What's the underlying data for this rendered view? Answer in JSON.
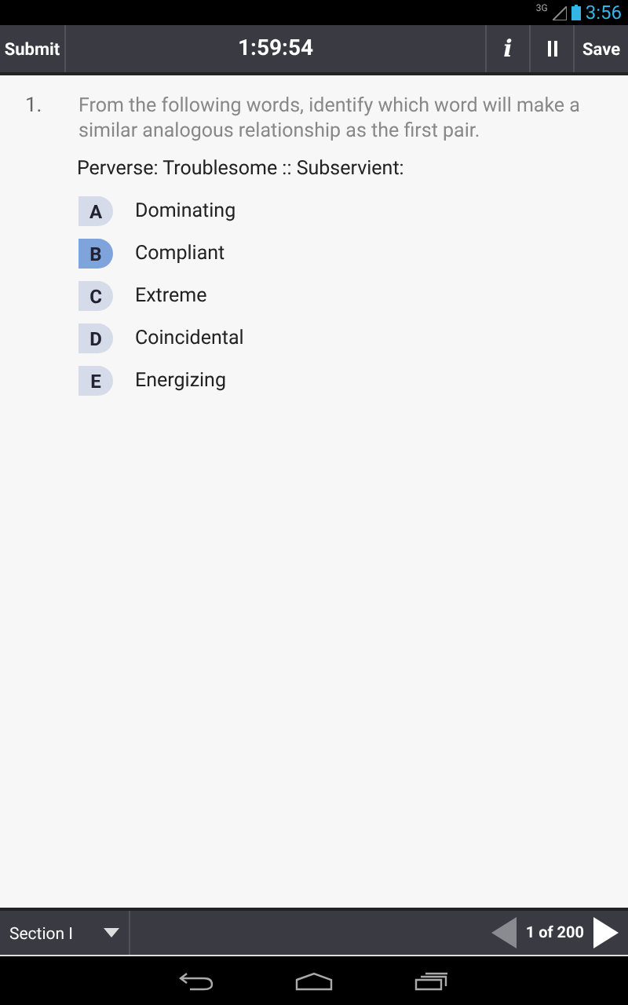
{
  "status_bar": {
    "time": "3:56",
    "network": "3G"
  },
  "toolbar": {
    "submit": "Submit",
    "timer": "1:59:54",
    "info": "i",
    "save": "Save"
  },
  "question": {
    "number": "1.",
    "text": "From the following words, identify which word will make a similar analogous relationship as the first pair.",
    "prompt": "Perverse: Troublesome :: Subservient:"
  },
  "options": [
    {
      "letter": "A",
      "label": "Dominating",
      "selected": false
    },
    {
      "letter": "B",
      "label": "Compliant",
      "selected": true
    },
    {
      "letter": "C",
      "label": "Extreme",
      "selected": false
    },
    {
      "letter": "D",
      "label": "Coincidental",
      "selected": false
    },
    {
      "letter": "E",
      "label": "Energizing",
      "selected": false
    }
  ],
  "footer": {
    "section": "Section I",
    "page": "1 of 200",
    "prev_disabled": true,
    "next_disabled": false
  }
}
